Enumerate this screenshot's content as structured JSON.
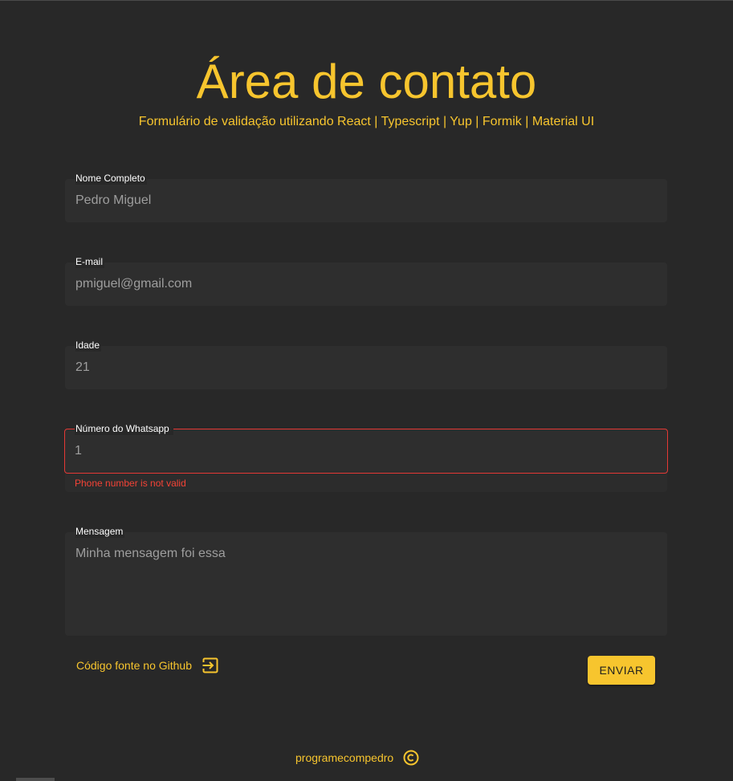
{
  "header": {
    "title": "Área de contato",
    "subtitle": "Formulário de validação utilizando React | Typescript | Yup | Formik | Material UI"
  },
  "form": {
    "fields": {
      "nome": {
        "label": "Nome Completo",
        "value": "Pedro Miguel"
      },
      "email": {
        "label": "E-mail",
        "value": "pmiguel@gmail.com"
      },
      "idade": {
        "label": "Idade",
        "value": "21"
      },
      "whatsapp": {
        "label": "Número do Whatsapp",
        "value": "1",
        "error": "Phone number is not valid"
      },
      "mensagem": {
        "label": "Mensagem",
        "value": "Minha mensagem foi essa"
      }
    },
    "github_link": "Código fonte no Github",
    "submit_label": "ENVIAR"
  },
  "footer": {
    "author": "programecompedro"
  },
  "colors": {
    "accent": "#f7c52e",
    "background": "#282828",
    "error": "#f44336"
  },
  "icons": {
    "github_link_icon": "exit-to-app-icon",
    "footer_icon": "copyright-icon"
  }
}
